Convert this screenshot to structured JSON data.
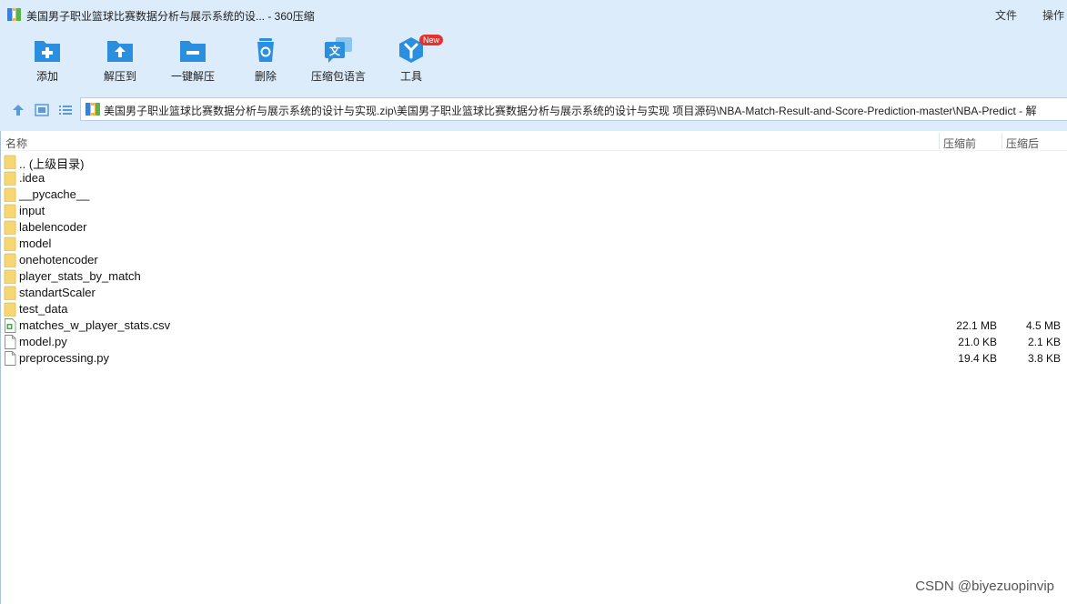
{
  "window": {
    "title": "美国男子职业篮球比赛数据分析与展示系统的设... - 360压缩",
    "menu": [
      "文件",
      "操作"
    ]
  },
  "toolbar": {
    "items": [
      {
        "label": "添加",
        "icon": "folder-add-icon"
      },
      {
        "label": "解压到",
        "icon": "folder-extract-icon"
      },
      {
        "label": "一键解压",
        "icon": "folder-quick-extract-icon"
      },
      {
        "label": "删除",
        "icon": "trash-icon"
      },
      {
        "label": "压缩包语言",
        "icon": "language-icon"
      },
      {
        "label": "工具",
        "icon": "tools-icon",
        "badge": "New"
      }
    ]
  },
  "address": {
    "path": "美国男子职业篮球比赛数据分析与展示系统的设计与实现.zip\\美国男子职业篮球比赛数据分析与展示系统的设计与实现 项目源码\\NBA-Match-Result-and-Score-Prediction-master\\NBA-Predict - 解"
  },
  "columns": {
    "name": "名称",
    "compressed_before": "压缩前",
    "compressed_after": "压缩后"
  },
  "files": [
    {
      "name": ".. (上级目录)",
      "type": "folder",
      "size": "",
      "packed": ""
    },
    {
      "name": ".idea",
      "type": "folder",
      "size": "",
      "packed": ""
    },
    {
      "name": "__pycache__",
      "type": "folder",
      "size": "",
      "packed": ""
    },
    {
      "name": "input",
      "type": "folder",
      "size": "",
      "packed": ""
    },
    {
      "name": "labelencoder",
      "type": "folder",
      "size": "",
      "packed": ""
    },
    {
      "name": "model",
      "type": "folder",
      "size": "",
      "packed": ""
    },
    {
      "name": "onehotencoder",
      "type": "folder",
      "size": "",
      "packed": ""
    },
    {
      "name": "player_stats_by_match",
      "type": "folder",
      "size": "",
      "packed": ""
    },
    {
      "name": "standartScaler",
      "type": "folder",
      "size": "",
      "packed": ""
    },
    {
      "name": "test_data",
      "type": "folder",
      "size": "",
      "packed": ""
    },
    {
      "name": "matches_w_player_stats.csv",
      "type": "csv",
      "size": "22.1 MB",
      "packed": "4.5 MB"
    },
    {
      "name": "model.py",
      "type": "file",
      "size": "21.0 KB",
      "packed": "2.1 KB"
    },
    {
      "name": "preprocessing.py",
      "type": "file",
      "size": "19.4 KB",
      "packed": "3.8 KB"
    }
  ],
  "watermark": "CSDN @biyezuopinvip",
  "colors": {
    "chrome": "#dcecfb",
    "accent": "#2b8fe0",
    "folder": "#f7d774"
  }
}
